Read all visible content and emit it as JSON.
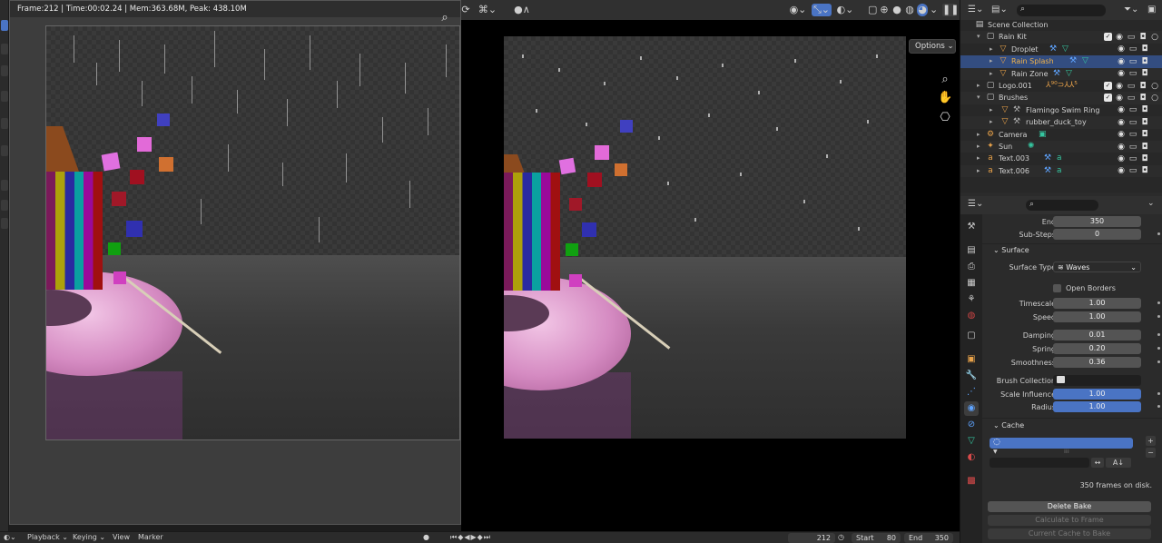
{
  "render_window": {
    "stats": "Frame:212 | Time:00:02.24 | Mem:363.68M, Peak: 438.10M"
  },
  "viewport": {
    "options_label": "Options"
  },
  "outliner": {
    "rows": [
      {
        "label": "Scene Collection"
      },
      {
        "label": "Rain Kit"
      },
      {
        "label": "Droplet"
      },
      {
        "label": "Rain Splash"
      },
      {
        "label": "Rain Zone"
      },
      {
        "label": "Logo.001"
      },
      {
        "label": "Brushes"
      },
      {
        "label": "Flamingo Swim Ring"
      },
      {
        "label": "rubber_duck_toy"
      },
      {
        "label": "Camera"
      },
      {
        "label": "Sun"
      },
      {
        "label": "Text.003"
      },
      {
        "label": "Text.006"
      }
    ]
  },
  "properties": {
    "end_label": "End",
    "end_value": "350",
    "substeps_label": "Sub-Steps",
    "substeps_value": "0",
    "surface_header": "Surface",
    "surface_type_label": "Surface Type",
    "surface_type_value": "Waves",
    "open_borders_label": "Open Borders",
    "timescale_label": "Timescale",
    "timescale_value": "1.00",
    "speed_label": "Speed",
    "speed_value": "1.00",
    "damping_label": "Damping",
    "damping_value": "0.01",
    "spring_label": "Spring",
    "spring_value": "0.20",
    "smoothness_label": "Smoothness",
    "smoothness_value": "0.36",
    "brush_collection_label": "Brush Collection",
    "scale_influence_label": "Scale Influence",
    "scale_influence_value": "1.00",
    "radius_label": "Radius",
    "radius_value": "1.00",
    "cache_header": "Cache",
    "frames_on_disk": "350 frames on disk.",
    "delete_bake": "Delete Bake",
    "calculate_to_frame": "Calculate to Frame",
    "current_cache_to_bake": "Current Cache to Bake"
  },
  "timeline": {
    "playback": "Playback",
    "keying": "Keying",
    "view": "View",
    "marker": "Marker",
    "current_frame": "212",
    "start_label": "Start",
    "start_value": "80",
    "end_label": "End",
    "end_value": "350"
  },
  "colors": {
    "selection_blue": "#334d80",
    "field_blue": "#4a74c4",
    "ring_pink": "#e8a9d8"
  }
}
